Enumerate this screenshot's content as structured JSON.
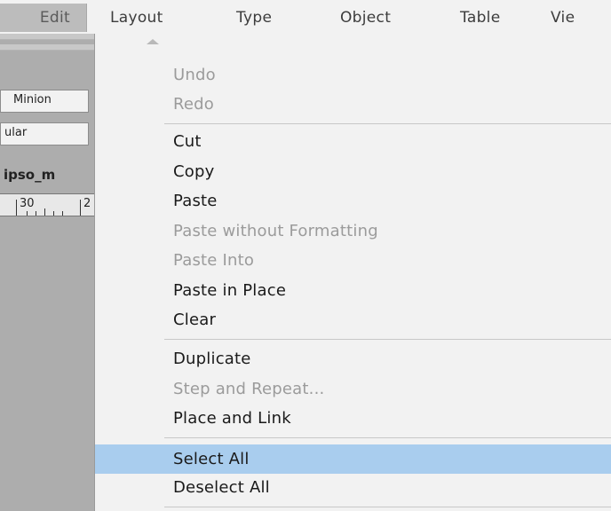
{
  "menubar": {
    "items": [
      "Edit",
      "Layout",
      "Type",
      "Object",
      "Table",
      "Vie"
    ]
  },
  "left_panel": {
    "font_field": "Minion",
    "style_field": "ular",
    "document_name": "ipso_m",
    "ruler_label_1": "30",
    "ruler_label_2": "2"
  },
  "edit_menu": {
    "items": [
      {
        "label": "Undo",
        "enabled": false
      },
      {
        "label": "Redo",
        "enabled": false
      },
      {
        "label": "Cut",
        "enabled": true
      },
      {
        "label": "Copy",
        "enabled": true
      },
      {
        "label": "Paste",
        "enabled": true
      },
      {
        "label": "Paste without Formatting",
        "enabled": false
      },
      {
        "label": "Paste Into",
        "enabled": false
      },
      {
        "label": "Paste in Place",
        "enabled": true
      },
      {
        "label": "Clear",
        "enabled": true
      },
      {
        "label": "Duplicate",
        "enabled": true
      },
      {
        "label": "Step and Repeat...",
        "enabled": false
      },
      {
        "label": "Place and Link",
        "enabled": true
      },
      {
        "label": "Select All",
        "enabled": true,
        "highlighted": true
      },
      {
        "label": "Deselect All",
        "enabled": true
      }
    ]
  },
  "colors": {
    "highlight": "#a9cdee",
    "disabled_text": "#9b9b9b",
    "panel_gray": "#adadad"
  }
}
